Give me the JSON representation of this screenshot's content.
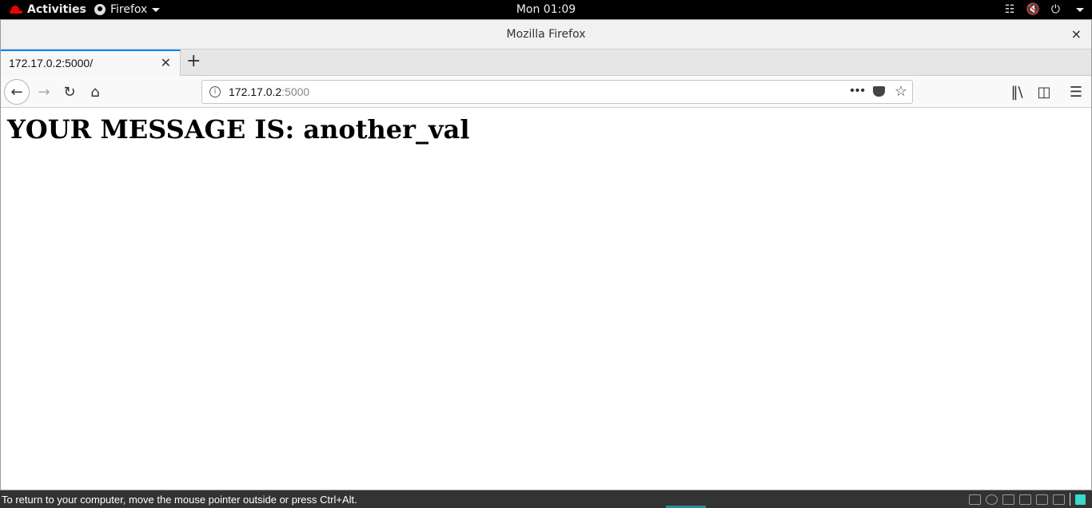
{
  "topbar": {
    "activities": "Activities",
    "app_menu": "Firefox",
    "clock": "Mon 01:09",
    "tray_icons": [
      "network-icon",
      "volume-muted-icon",
      "power-icon"
    ]
  },
  "window": {
    "title": "Mozilla Firefox",
    "close_glyph": "×"
  },
  "tabs": [
    {
      "label": "172.17.0.2:5000/",
      "active": true
    }
  ],
  "urlbar": {
    "host": "172.17.0.2",
    "port": ":5000"
  },
  "page": {
    "heading": "YOUR MESSAGE IS: another_val"
  },
  "statusbar": {
    "message": "To return to your computer, move the mouse pointer outside or press Ctrl+Alt."
  },
  "colors": {
    "accent": "#0a84ff",
    "topbar_bg": "#000000",
    "statusbar_bg": "#333333",
    "redhat_red": "#ee0000"
  }
}
